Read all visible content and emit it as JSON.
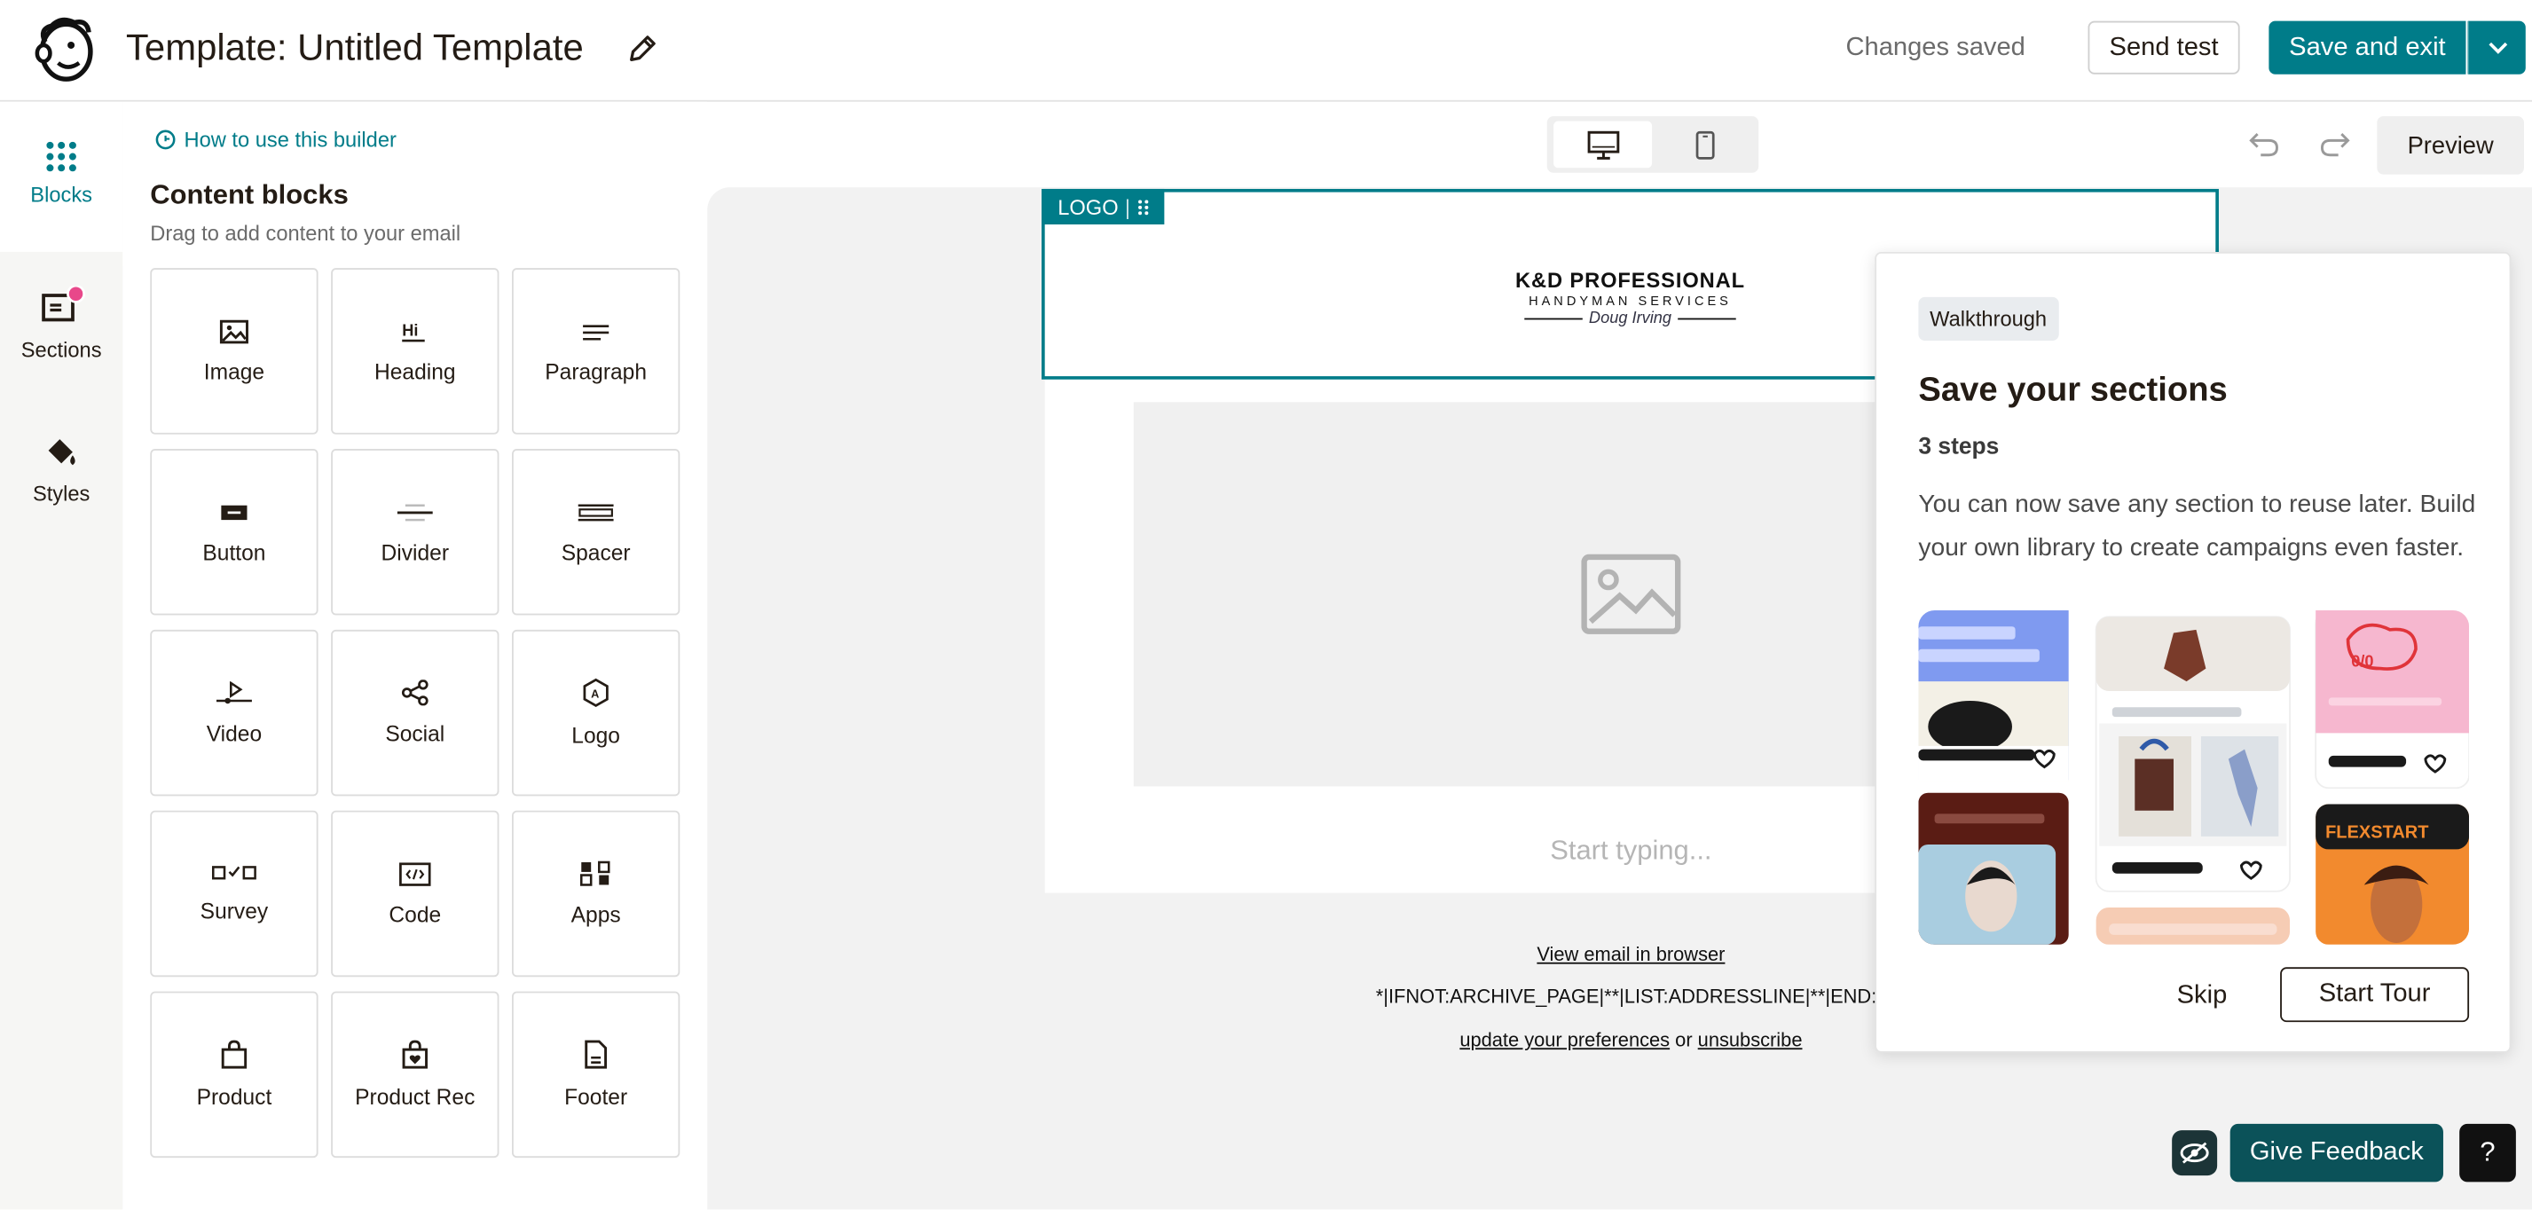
{
  "header": {
    "title": "Template: Untitled Template",
    "status": "Changes saved",
    "send_test": "Send test",
    "save_exit": "Save and exit"
  },
  "rail": {
    "items": [
      {
        "label": "Blocks",
        "icon": "grid-icon"
      },
      {
        "label": "Sections",
        "icon": "sections-icon"
      },
      {
        "label": "Styles",
        "icon": "paint-bucket-icon"
      }
    ]
  },
  "panel": {
    "howto": "How to use this builder",
    "title": "Content blocks",
    "subtitle": "Drag to add content to your email",
    "blocks": [
      {
        "label": "Image",
        "icon": "image-icon"
      },
      {
        "label": "Heading",
        "icon": "heading-icon"
      },
      {
        "label": "Paragraph",
        "icon": "paragraph-icon"
      },
      {
        "label": "Button",
        "icon": "button-icon"
      },
      {
        "label": "Divider",
        "icon": "divider-icon"
      },
      {
        "label": "Spacer",
        "icon": "spacer-icon"
      },
      {
        "label": "Video",
        "icon": "video-icon"
      },
      {
        "label": "Social",
        "icon": "share-icon"
      },
      {
        "label": "Logo",
        "icon": "logo-icon"
      },
      {
        "label": "Survey",
        "icon": "survey-icon"
      },
      {
        "label": "Code",
        "icon": "code-icon"
      },
      {
        "label": "Apps",
        "icon": "apps-icon"
      },
      {
        "label": "Product",
        "icon": "bag-icon"
      },
      {
        "label": "Product Rec",
        "icon": "bag-heart-icon"
      },
      {
        "label": "Footer",
        "icon": "document-icon"
      }
    ]
  },
  "toolbar": {
    "preview": "Preview"
  },
  "email": {
    "logo_tag": "LOGO",
    "brand_line1": "K&D PROFESSIONAL",
    "brand_line2": "HANDYMAN SERVICES",
    "brand_signature": "Doug Irving",
    "placeholder_text": "Start typing...",
    "view_in_browser": "View email in browser",
    "merge_tags": "*|IFNOT:ARCHIVE_PAGE|**|LIST:ADDRESSLINE|**|END:IF",
    "prefs_link": "update your preferences",
    "prefs_or": " or ",
    "unsubscribe": "unsubscribe"
  },
  "walkthrough": {
    "badge": "Walkthrough",
    "title": "Save your sections",
    "steps": "3 steps",
    "body": "You can now save any section to reuse later. Build your own library to create campaigns even faster.",
    "collage_label": "FLEXSTART",
    "skip": "Skip",
    "start": "Start Tour"
  },
  "bottom": {
    "feedback": "Give Feedback",
    "help": "?"
  },
  "colors": {
    "accent": "#007c89",
    "feedback": "#0b5259"
  }
}
